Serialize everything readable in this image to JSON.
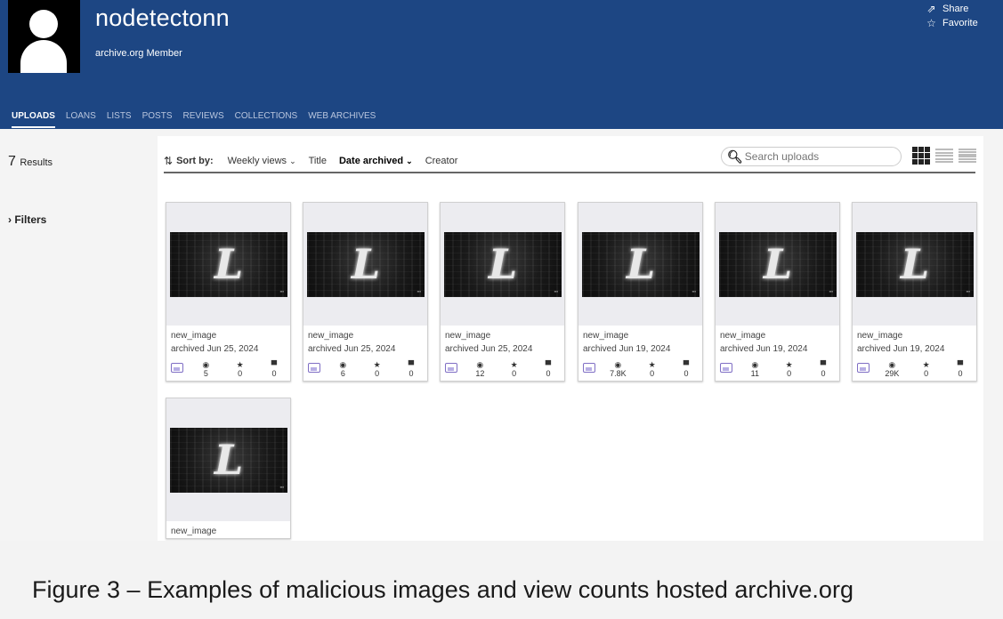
{
  "header": {
    "username": "nodetectonn",
    "subtitle": "archive.org Member",
    "share_label": "Share",
    "favorite_label": "Favorite"
  },
  "tabs": [
    {
      "label": "UPLOADS",
      "active": true
    },
    {
      "label": "LOANS"
    },
    {
      "label": "LISTS"
    },
    {
      "label": "POSTS"
    },
    {
      "label": "REVIEWS"
    },
    {
      "label": "COLLECTIONS"
    },
    {
      "label": "WEB ARCHIVES"
    }
  ],
  "sidebar": {
    "results_count": "7",
    "results_label": "Results",
    "filters_label": "› Filters"
  },
  "sortbar": {
    "sort_by_label": "Sort by:",
    "options": [
      "Weekly views",
      "Title",
      "Date archived",
      "Creator"
    ],
    "active_option": "Date archived",
    "search_placeholder": "Search uploads"
  },
  "items": [
    {
      "title": "new_image",
      "date": "archived Jun 25, 2024",
      "views": "5",
      "favorites": "0",
      "comments": "0"
    },
    {
      "title": "new_image",
      "date": "archived Jun 25, 2024",
      "views": "6",
      "favorites": "0",
      "comments": "0"
    },
    {
      "title": "new_image",
      "date": "archived Jun 25, 2024",
      "views": "12",
      "favorites": "0",
      "comments": "0"
    },
    {
      "title": "new_image",
      "date": "archived Jun 19, 2024",
      "views": "7.8K",
      "favorites": "0",
      "comments": "0"
    },
    {
      "title": "new_image",
      "date": "archived Jun 19, 2024",
      "views": "11",
      "favorites": "0",
      "comments": "0"
    },
    {
      "title": "new_image",
      "date": "archived Jun 19, 2024",
      "views": "29K",
      "favorites": "0",
      "comments": "0"
    },
    {
      "title": "new_image"
    }
  ],
  "image_glyph": "L",
  "caption": "Figure 3 – Examples of malicious images and view counts hosted archive.org",
  "colors": {
    "header_bg": "#1d4683",
    "mediatype_icon": "#7f6ec4"
  },
  "icons": {
    "share": "share-icon",
    "favorite": "star-icon",
    "search": "search-icon",
    "views": "eye-icon",
    "favorites": "star-icon",
    "comments": "comment-icon",
    "mediatype": "image-icon"
  }
}
